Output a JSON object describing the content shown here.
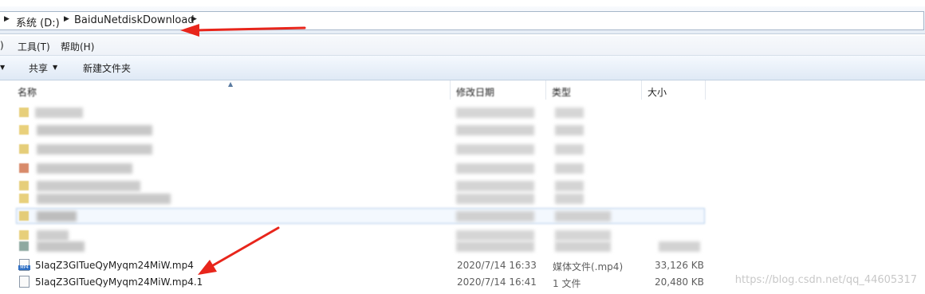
{
  "address_bar": {
    "crumbs": [
      "系统 (D:)",
      "BaiduNetdiskDownload"
    ]
  },
  "menu": {
    "items": [
      ")",
      "工具(T)",
      "帮助(H)"
    ]
  },
  "toolbar": {
    "share_label": "共享",
    "new_folder_label": "新建文件夹"
  },
  "columns": {
    "name": "名称",
    "modified": "修改日期",
    "type": "类型",
    "size": "大小"
  },
  "files": [
    {
      "name": "5IaqZ3GITueQyMyqm24MiW.mp4",
      "modified": "2020/7/14 16:33",
      "type": "媒体文件(.mp4)",
      "size": "33,126 KB",
      "icon": "mp4-file-icon"
    },
    {
      "name": "5IaqZ3GITueQyMyqm24MiW.mp4.1",
      "modified": "2020/7/14 16:41",
      "type": "1 文件",
      "size": "20,480 KB",
      "icon": "generic-file-icon"
    }
  ],
  "watermark": "https://blog.csdn.net/qq_44605317",
  "colors": {
    "annotation_arrow": "#e8251b",
    "folder": "#e7cf7a"
  }
}
